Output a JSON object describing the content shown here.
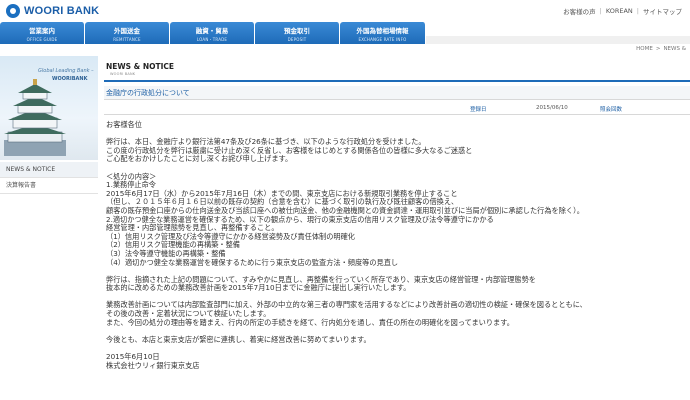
{
  "header": {
    "logo_text": "WOORI BANK",
    "util_links": [
      "お客様の声",
      "KOREAN",
      "サイトマップ"
    ]
  },
  "nav": [
    {
      "label": "営業案内",
      "sub": "OFFICE GUIDE"
    },
    {
      "label": "外国送金",
      "sub": "REMITTANCE"
    },
    {
      "label": "融資・貿易",
      "sub": "LOAN・TRADE"
    },
    {
      "label": "預金取引",
      "sub": "DEPOSIT"
    },
    {
      "label": "外国為替相場情報",
      "sub": "EXCHANGE RATE INFO"
    }
  ],
  "breadcrumb": [
    "HOME",
    "NEWS &"
  ],
  "sidebar": {
    "banner_line1": "Global Leading Bank –",
    "banner_line2": "WOORIBANK",
    "items": [
      "NEWS & NOTICE",
      "決算報告書"
    ]
  },
  "section": {
    "title": "NEWS & NOTICE",
    "subtitle": "WOORI BANK"
  },
  "post": {
    "title": "金融庁の行政処分について",
    "date_label": "登録日",
    "date": "2015/06/10",
    "views_label": "照会回数",
    "views": "",
    "body": [
      "お客様各位",
      "",
      "弊行は、本日、金融庁より銀行法第47条及び26条に基づき、以下のような行政処分を受けました。",
      "この度の行政処分を弊行は厳粛に受け止め深く反省し、お客様をはじめとする関係各位の皆様に多大なるご迷惑と",
      "ご心配をおかけしたことに対し深くお詫び申し上げます。",
      "",
      "＜処分の内容＞",
      "1.業務停止命令",
      "2015年6月17日（水）から2015年7月16日（木）までの間、東京支店における新規取引業務を停止すること",
      "（但し、２０１５年６月１６日以前の既存の契約（合意を含む）に基づく取引の執行及び既往顧客の借換え、",
      "顧客の既存預金口座からの仕向送金及び当該口座への被仕向送金、他の金融機関との資金調達・運用取引並びに当局が個別に承認した行為を除く）。",
      "2.適切かつ健全な業務運営を確保するため、以下の観点から、現行の東京支店の信用リスク管理及び法令等遵守にかかる",
      "経営管理・内部管理態勢を見直し、再整備すること。",
      "（1）信用リスク管理及び法令等遵守にかかる経営姿勢及び責任体制の明確化",
      "（2）信用リスク管理機能の再構築・整備",
      "（3）法令等遵守機能の再構築・整備",
      "（4）適切かつ健全な業務運営を確保するために行う東京支店の監査方法・頻度等の見直し",
      "",
      "弊行は、指摘された上記の問題について、すみやかに見直し、再整備を行っていく所存であり、東京支店の経営管理・内部管理態勢を",
      "抜本的に改めるための業務改善計画を2015年7月10日までに金融庁に提出し実行いたします。",
      "",
      "業務改善計画については内部監査部門に加え、外部の中立的な第三者の専門家を活用するなどにより改善計画の適切性の検証・確保を図るとともに、",
      "その後の改善・定着状況について検証いたします。",
      "また、今回の処分の理由等を踏まえ、行内の所定の手続きを経て、行内処分を通し、責任の所在の明確化を図ってまいります。",
      "",
      "今後とも、本店と東京支店が緊密に連携し、着実に経営改善に努めてまいります。",
      "",
      "2015年6月10日",
      "株式会社ウリィ銀行東京支店"
    ]
  }
}
